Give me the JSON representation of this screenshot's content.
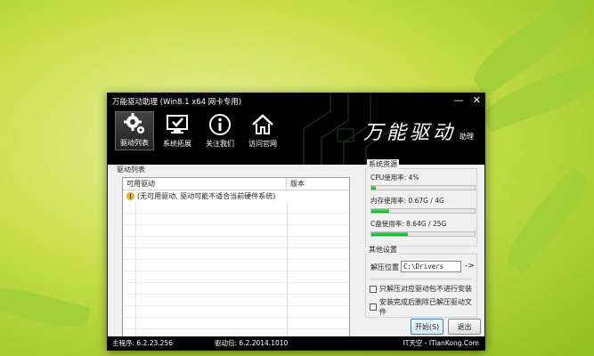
{
  "window": {
    "title": "万能驱动助理 (Win8.1 x64 网卡专用)",
    "controls": [
      "—",
      "✕"
    ]
  },
  "toolbar": [
    {
      "label": "驱动列表",
      "icon": "gear-icon",
      "active": true
    },
    {
      "label": "系统拓展",
      "icon": "monitor-check-icon",
      "active": false
    },
    {
      "label": "关注我们",
      "icon": "info-icon",
      "active": false
    },
    {
      "label": "访问官网",
      "icon": "home-icon",
      "active": false
    }
  ],
  "brand": {
    "main": "万能驱动",
    "sub": "助理"
  },
  "driver_list": {
    "group_title": "驱动列表",
    "columns": [
      "可用驱动",
      "版本"
    ],
    "rows": [
      {
        "icon": "warning-icon",
        "name": "(无可用驱动, 驱动可能不适合当前硬件系统)",
        "version": ""
      }
    ]
  },
  "system_resources": {
    "group_title": "系统资源",
    "items": [
      {
        "label": "CPU使用率:  4%",
        "fraction": 0.04
      },
      {
        "label": "内存使用率: 0.67G / 4G",
        "fraction": 0.17
      },
      {
        "label": "C盘使用率:  8.64G / 25G",
        "fraction": 0.35
      }
    ]
  },
  "other_settings": {
    "group_title": "其他设置",
    "unzip_label": "解压位置",
    "unzip_path": "C:\\Drivers",
    "arrow": "->",
    "options": [
      {
        "label": "只解压对应驱动包不进行安装",
        "checked": false
      },
      {
        "label": "安装完成后删除已解压驱动文件",
        "checked": false
      }
    ]
  },
  "buttons": {
    "start": "开始(S)",
    "exit": "退出"
  },
  "status": {
    "main": "主程序: 6.2.23.256",
    "pkg": "驱动包: 6.2.2014.1010",
    "site": "IT天空 - ITianKong.Com"
  },
  "colors": {
    "progress": "#06b025",
    "titlebar": "#000000"
  }
}
